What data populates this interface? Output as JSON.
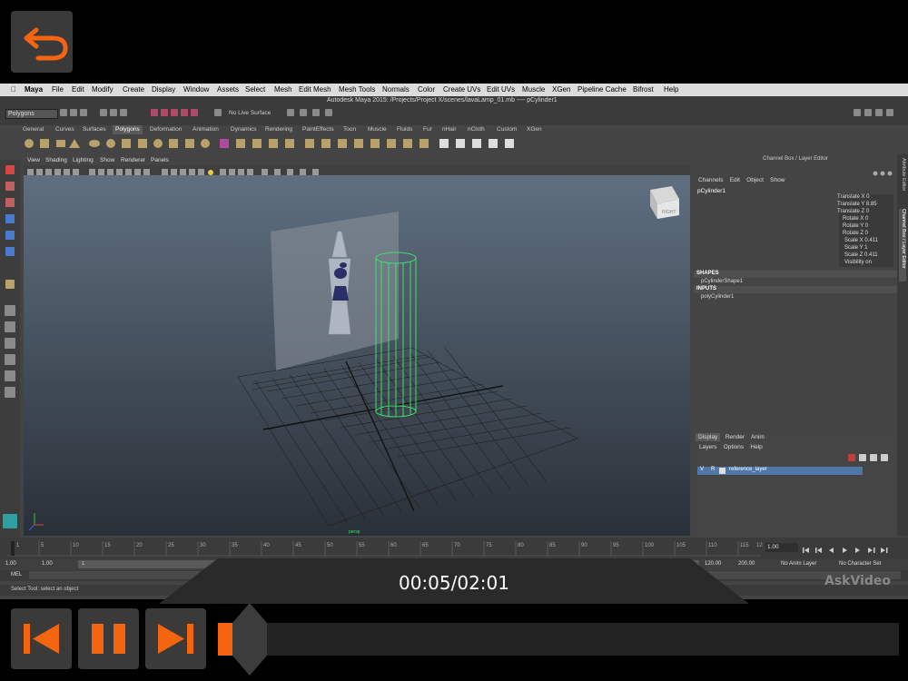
{
  "colors": {
    "accent": "#f5640f",
    "selection_green": "#3fe06a",
    "layer_blue": "#4f78a8"
  },
  "back_button": {
    "icon": "undo-arrow-icon"
  },
  "maya": {
    "menu": [
      "Maya",
      "File",
      "Edit",
      "Modify",
      "Create",
      "Display",
      "Window",
      "Assets",
      "Select",
      "Mesh",
      "Edit Mesh",
      "Mesh Tools",
      "Normals",
      "Color",
      "Create UVs",
      "Edit UVs",
      "Muscle",
      "XGen",
      "Pipeline Cache",
      "Bifrost",
      "Help"
    ],
    "window_title": "Autodesk Maya 2015: /Projects/Project X/scenes/lavaLamp_01.mb  ----  pCylinder1",
    "mode": "Polygons",
    "no_live": "No Live Surface",
    "shelf_tabs": [
      "General",
      "Curves",
      "Surfaces",
      "Polygons",
      "Deformation",
      "Animation",
      "Dynamics",
      "Rendering",
      "PaintEffects",
      "Toon",
      "Muscle",
      "Fluids",
      "Fur",
      "nHair",
      "nCloth",
      "Custom",
      "XGen"
    ],
    "shelf_active": "Polygons",
    "view_menu": [
      "View",
      "Shading",
      "Lighting",
      "Show",
      "Renderer",
      "Panels"
    ],
    "viewcube_label": "RIGHT",
    "persp_label": "persp",
    "channel_box": {
      "title": "Channel Box / Layer Editor",
      "menu": [
        "Channels",
        "Edit",
        "Object",
        "Show"
      ],
      "object": "pCylinder1",
      "channels": [
        "Translate X 0",
        "Translate Y 8.85",
        "Translate Z 0",
        "Rotate X 0",
        "Rotate Y 0",
        "Rotate Z 0",
        "Scale X 0.411",
        "Scale Y 1",
        "Scale Z 0.411",
        "Visibility on"
      ],
      "shapes_header": "SHAPES",
      "shape": "pCylinderShape1",
      "inputs_header": "INPUTS",
      "input": "polyCylinder1"
    },
    "side_tabs": [
      "Attribute Editor",
      "Channel Box / Layer Editor"
    ],
    "layer_editor": {
      "tabs": [
        "Display",
        "Render",
        "Anim"
      ],
      "menu": [
        "Layers",
        "Options",
        "Help"
      ],
      "layer": {
        "v": "V",
        "p": "R",
        "name": "reference_layer"
      }
    },
    "timeline": {
      "ticks": [
        "1",
        "5",
        "10",
        "15",
        "20",
        "25",
        "30",
        "35",
        "40",
        "45",
        "50",
        "55",
        "60",
        "65",
        "70",
        "75",
        "80",
        "85",
        "90",
        "95",
        "100",
        "105",
        "110",
        "115",
        "12"
      ],
      "current": "1.00"
    },
    "range": {
      "start": "1.00",
      "start2": "1.00",
      "range_start": "1",
      "end": "120.00",
      "end2": "200.00",
      "anim_layer": "No Anim Layer",
      "char_set": "No Character Set"
    },
    "mel_label": "MEL",
    "help_line": "Select Tool: select an object"
  },
  "player": {
    "time": "00:05/02:01",
    "brand": "AskVideo",
    "progress": 0.04
  }
}
